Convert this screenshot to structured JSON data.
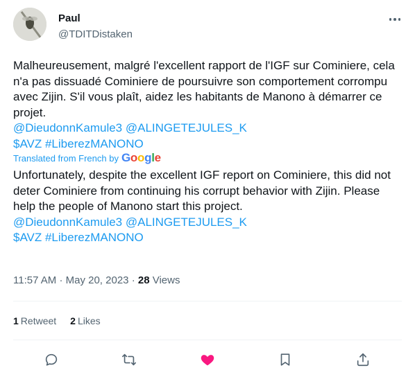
{
  "user": {
    "name": "Paul",
    "handle": "@TDITDistaken"
  },
  "tweet": {
    "original_text": "Malheureusement, malgré l'excellent rapport de l'IGF sur Cominiere, cela n'a pas dissuadé Cominiere de poursuivre son comportement corrompu avec Zijin. S'il vous plaît, aidez les habitants de Manono à démarrer ce projet.",
    "original_mentions": "@DieudonnKamule3 @ALINGETEJULES_K",
    "original_tags": "$AVZ #LiberezMANONO",
    "translated_from_label": "Translated from French by",
    "translator_logo": "Google",
    "translated_text": "Unfortunately, despite the excellent IGF report on Cominiere, this did not deter Cominiere from continuing his corrupt behavior with Zijin. Please help the people of Manono start this project.",
    "translated_mentions": "@DieudonnKamule3 @ALINGETEJULES_K",
    "translated_tags": "$AVZ #LiberezMANONO"
  },
  "meta": {
    "time": "11:57 AM",
    "separator": "·",
    "date": "May 20, 2023",
    "views_count": "28",
    "views_label": "Views"
  },
  "stats": {
    "retweets_count": "1",
    "retweets_label": "Retweet",
    "likes_count": "2",
    "likes_label": "Likes"
  },
  "icons": {
    "more": "more-dots-icon",
    "reply": "reply-icon",
    "retweet": "retweet-icon",
    "like": "heart-icon",
    "bookmark": "bookmark-icon",
    "share": "share-icon"
  },
  "colors": {
    "accent": "#1d9bf0",
    "like": "#f91880",
    "muted": "#536471",
    "text": "#0f1419"
  }
}
